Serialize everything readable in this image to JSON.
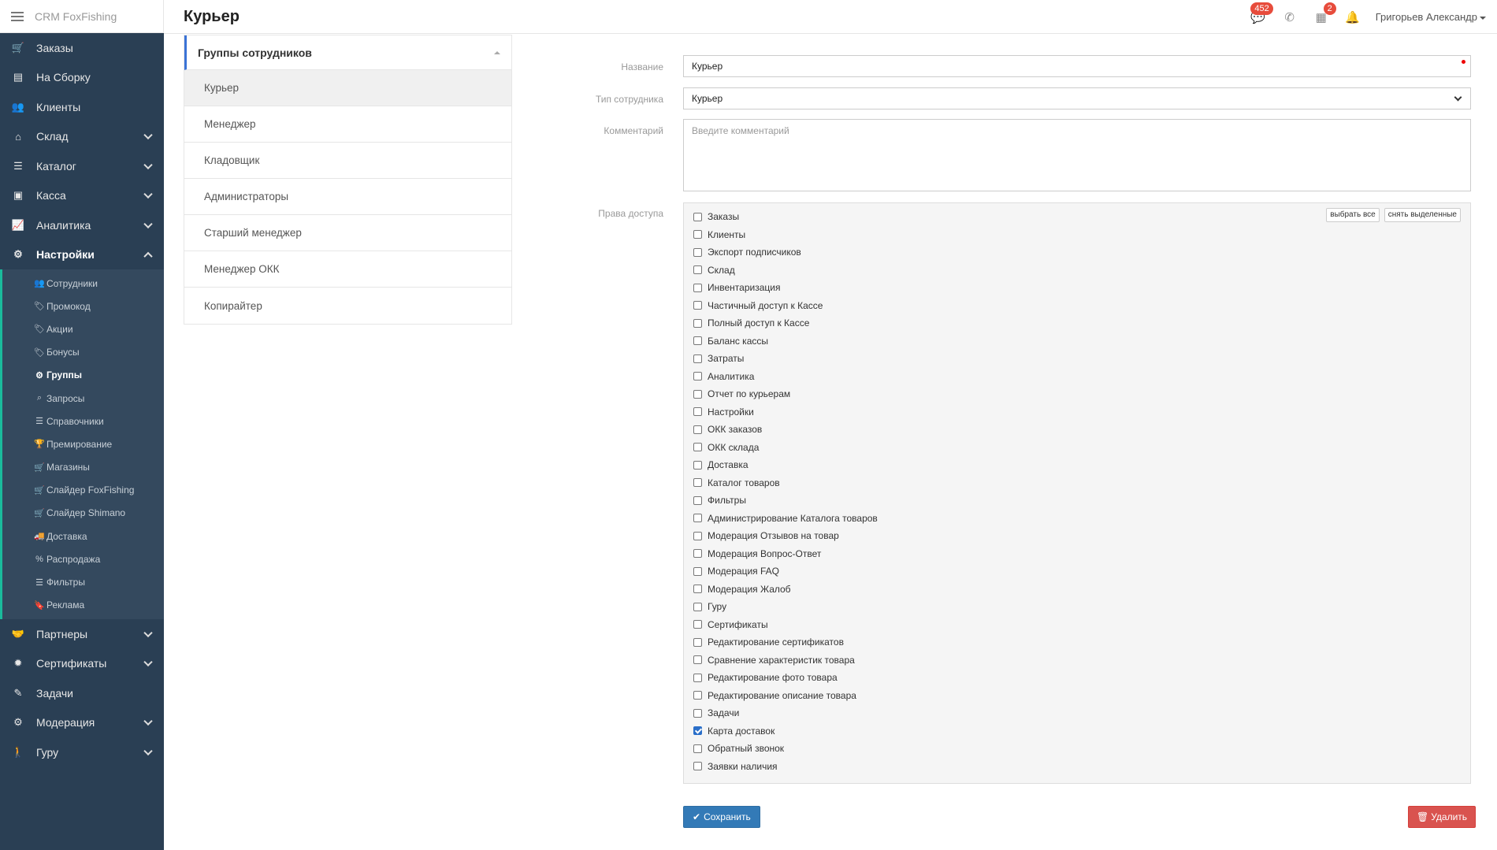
{
  "brand": {
    "name": "CRM FoxFishing"
  },
  "header": {
    "title": "Курьер",
    "messages_badge": "452",
    "calendar_badge": "2",
    "user_name": "Григорьев Александр"
  },
  "sidebar": {
    "items": [
      {
        "label": "Заказы",
        "icon": "cart-icon"
      },
      {
        "label": "На Сборку",
        "icon": "box-icon"
      },
      {
        "label": "Клиенты",
        "icon": "users-icon"
      },
      {
        "label": "Склад",
        "icon": "home-icon"
      },
      {
        "label": "Каталог",
        "icon": "list-icon"
      },
      {
        "label": "Касса",
        "icon": "money-icon"
      },
      {
        "label": "Аналитика",
        "icon": "chart-icon"
      },
      {
        "label": "Настройки",
        "icon": "gears-icon"
      }
    ],
    "submenu": [
      {
        "label": "Сотрудники"
      },
      {
        "label": "Промокод"
      },
      {
        "label": "Акции"
      },
      {
        "label": "Бонусы"
      },
      {
        "label": "Группы"
      },
      {
        "label": "Запросы"
      },
      {
        "label": "Справочники"
      },
      {
        "label": "Премирование"
      },
      {
        "label": "Магазины"
      },
      {
        "label": "Слайдер FoxFishing"
      },
      {
        "label": "Слайдер Shimano"
      },
      {
        "label": "Доставка"
      },
      {
        "label": "Распродажа"
      },
      {
        "label": "Фильтры"
      },
      {
        "label": "Реклама"
      }
    ],
    "items_after": [
      {
        "label": "Партнеры"
      },
      {
        "label": "Сертификаты"
      },
      {
        "label": "Задачи"
      },
      {
        "label": "Модерация"
      },
      {
        "label": "Гуру"
      }
    ]
  },
  "groups": {
    "title": "Группы сотрудников",
    "items": [
      "Курьер",
      "Менеджер",
      "Кладовщик",
      "Администраторы",
      "Старший менеджер",
      "Менеджер ОКК",
      "Копирайтер"
    ]
  },
  "form": {
    "name_label": "Название",
    "name_value": "Курьер",
    "type_label": "Тип сотрудника",
    "type_value": "Курьер",
    "comment_label": "Комментарий",
    "comment_placeholder": "Введите комментарий",
    "perms_label": "Права доступа",
    "select_all": "выбрать все",
    "deselect": "снять выделенные",
    "permissions": [
      "Заказы",
      "Клиенты",
      "Экспорт подписчиков",
      "Склад",
      "Инвентаризация",
      "Частичный доступ к Кассе",
      "Полный доступ к Кассе",
      "Баланс кассы",
      "Затраты",
      "Аналитика",
      "Отчет по курьерам",
      "Настройки",
      "ОКК заказов",
      "ОКК склада",
      "Доставка",
      "Каталог товаров",
      "Фильтры",
      "Администрирование Каталога товаров",
      "Модерация Отзывов на товар",
      "Модерация Вопрос-Ответ",
      "Модерация FAQ",
      "Модерация Жалоб",
      "Гуру",
      "Сертификаты",
      "Редактирование сертификатов",
      "Сравнение характеристик товара",
      "Редактирование фото товара",
      "Редактирование описание товара",
      "Задачи",
      "Карта доставок",
      "Обратный звонок",
      "Заявки наличия"
    ],
    "checked": [
      "Карта доставок"
    ],
    "save_label": "Сохранить",
    "delete_label": "Удалить"
  }
}
